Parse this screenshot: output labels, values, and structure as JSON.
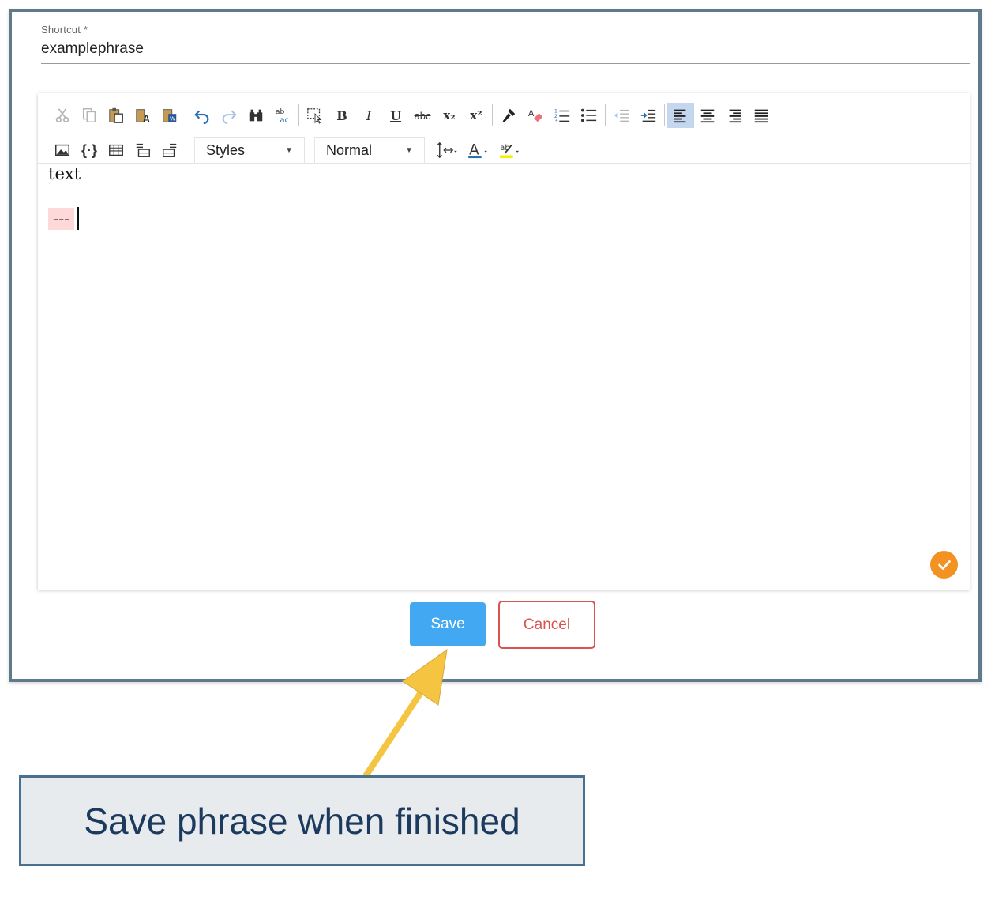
{
  "form": {
    "shortcut_label": "Shortcut *",
    "shortcut_value": "examplephrase"
  },
  "toolbar": {
    "bold": "B",
    "italic": "I",
    "underline": "U",
    "strike": "abc",
    "subscript": "x₂",
    "superscript": "x²",
    "source": "{·}",
    "styles_combo": "Styles",
    "format_combo": "Normal"
  },
  "editor": {
    "line1": "text",
    "line2": "---"
  },
  "buttons": {
    "save": "Save",
    "cancel": "Cancel"
  },
  "callout": {
    "text": "Save phrase when finished"
  },
  "colors": {
    "save": "#43a8f2",
    "cancel": "#d9534f",
    "check": "#f39222",
    "arrow": "#f5c542",
    "callout_border": "#4a7090"
  }
}
